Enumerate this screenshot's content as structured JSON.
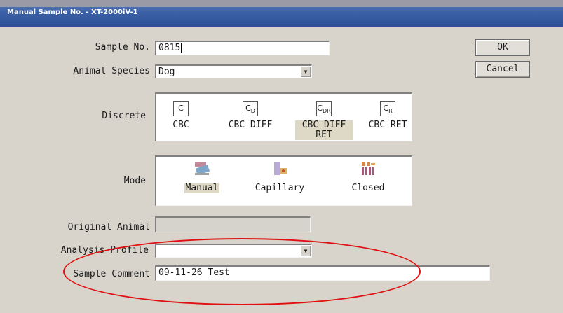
{
  "window": {
    "title": "Manual Sample No. - XT-2000iV-1"
  },
  "labels": {
    "sample_no": "Sample No.",
    "animal_species": "Animal Species",
    "discrete": "Discrete",
    "mode": "Mode",
    "original_animal": "Original Animal",
    "analysis_profile": "Analysis Profile",
    "sample_comment": "Sample Comment"
  },
  "fields": {
    "sample_no": "0815",
    "animal_species": "Dog",
    "original_animal": "",
    "analysis_profile": "",
    "sample_comment": "09-11-26 Test"
  },
  "buttons": {
    "ok": "OK",
    "cancel": "Cancel"
  },
  "discrete_options": [
    {
      "icon_text": "C",
      "sub": "",
      "label": "CBC",
      "selected": false
    },
    {
      "icon_text": "C",
      "sub": "D",
      "label": "CBC DIFF",
      "selected": false
    },
    {
      "icon_text": "C",
      "sub": "DR",
      "label": "CBC DIFF RET",
      "selected": true
    },
    {
      "icon_text": "C",
      "sub": "R",
      "label": "CBC RET",
      "selected": false
    }
  ],
  "mode_options": [
    {
      "label": "Manual",
      "selected": true,
      "icon": "manual-sample-icon"
    },
    {
      "label": "Capillary",
      "selected": false,
      "icon": "capillary-icon"
    },
    {
      "label": "Closed",
      "selected": false,
      "icon": "closed-tube-rack-icon"
    }
  ],
  "colors": {
    "title_bar": "#2c4f95",
    "annotation_ellipse": "#e01010",
    "selected_highlight": "#ddd9c6"
  }
}
